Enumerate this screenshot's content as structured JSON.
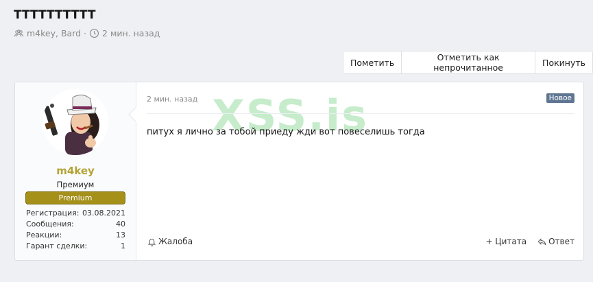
{
  "thread": {
    "title": "TTTTTTTTTT",
    "participants": "m4key, Bard",
    "separator": "·",
    "time": "2 мин. назад"
  },
  "actions": {
    "mark": "Пометить",
    "mark_unread": "Отметить как непрочитанное",
    "leave": "Покинуть"
  },
  "user": {
    "name": "m4key",
    "title": "Премиум",
    "banner": "Premium",
    "stats": [
      {
        "label": "Регистрация:",
        "value": "03.08.2021"
      },
      {
        "label": "Сообщения:",
        "value": "40"
      },
      {
        "label": "Реакции:",
        "value": "13"
      },
      {
        "label": "Гарант сделки:",
        "value": "1"
      }
    ]
  },
  "message": {
    "time": "2 мин. назад",
    "badge": "Новое",
    "text": "питух я лично за тобой приеду жди вот повеселишь тогда",
    "watermark": "XSS.is"
  },
  "footer": {
    "report": "Жалоба",
    "quote": "+ Цитата",
    "reply": "Ответ"
  },
  "colors": {
    "username": "#b3a337",
    "banner": "#a5901a",
    "badge": "#5f7692",
    "watermark": "#78d282"
  }
}
